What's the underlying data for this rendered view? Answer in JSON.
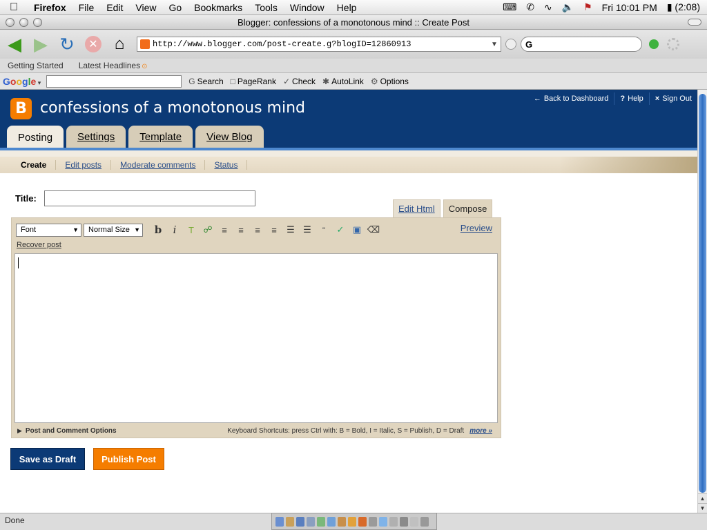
{
  "menubar": {
    "app": "Firefox",
    "items": [
      "File",
      "Edit",
      "View",
      "Go",
      "Bookmarks",
      "Tools",
      "Window",
      "Help"
    ],
    "clock": "Fri 10:01 PM",
    "battery": "(2:08)"
  },
  "window": {
    "title": "Blogger: confessions of a monotonous mind :: Create Post"
  },
  "navbar": {
    "url": "http://www.blogger.com/post-create.g?blogID=12860913",
    "search_engine_glyph": "G"
  },
  "bookmarks": [
    "Getting Started",
    "Latest Headlines"
  ],
  "google_toolbar": {
    "logo": "Google",
    "items": [
      "Search",
      "PageRank",
      "Check",
      "AutoLink",
      "Options"
    ]
  },
  "blog": {
    "title": "confessions of a monotonous mind",
    "logo_letter": "B",
    "top_links": [
      "Back to Dashboard",
      "Help",
      "Sign Out"
    ],
    "tabs": [
      "Posting",
      "Settings",
      "Template",
      "View Blog"
    ],
    "active_tab": "Posting",
    "subnav": [
      "Create",
      "Edit posts",
      "Moderate comments",
      "Status"
    ]
  },
  "editor": {
    "title_label": "Title:",
    "title_value": "",
    "mode_tabs": [
      "Edit Html",
      "Compose"
    ],
    "active_mode": "Compose",
    "font_select": "Font",
    "size_select": "Normal Size",
    "preview": "Preview",
    "recover": "Recover post",
    "post_options": "Post and Comment Options",
    "shortcuts": "Keyboard Shortcuts: press Ctrl with: B = Bold,  I = Italic,  S = Publish,  D = Draft",
    "more": "more »",
    "body": ""
  },
  "buttons": {
    "draft": "Save as Draft",
    "publish": "Publish Post"
  },
  "status": "Done",
  "colors": {
    "blogger_navy": "#0c3a76",
    "blogger_orange": "#f57d00",
    "tan": "#e0d5bf",
    "link": "#2a4e8a"
  }
}
